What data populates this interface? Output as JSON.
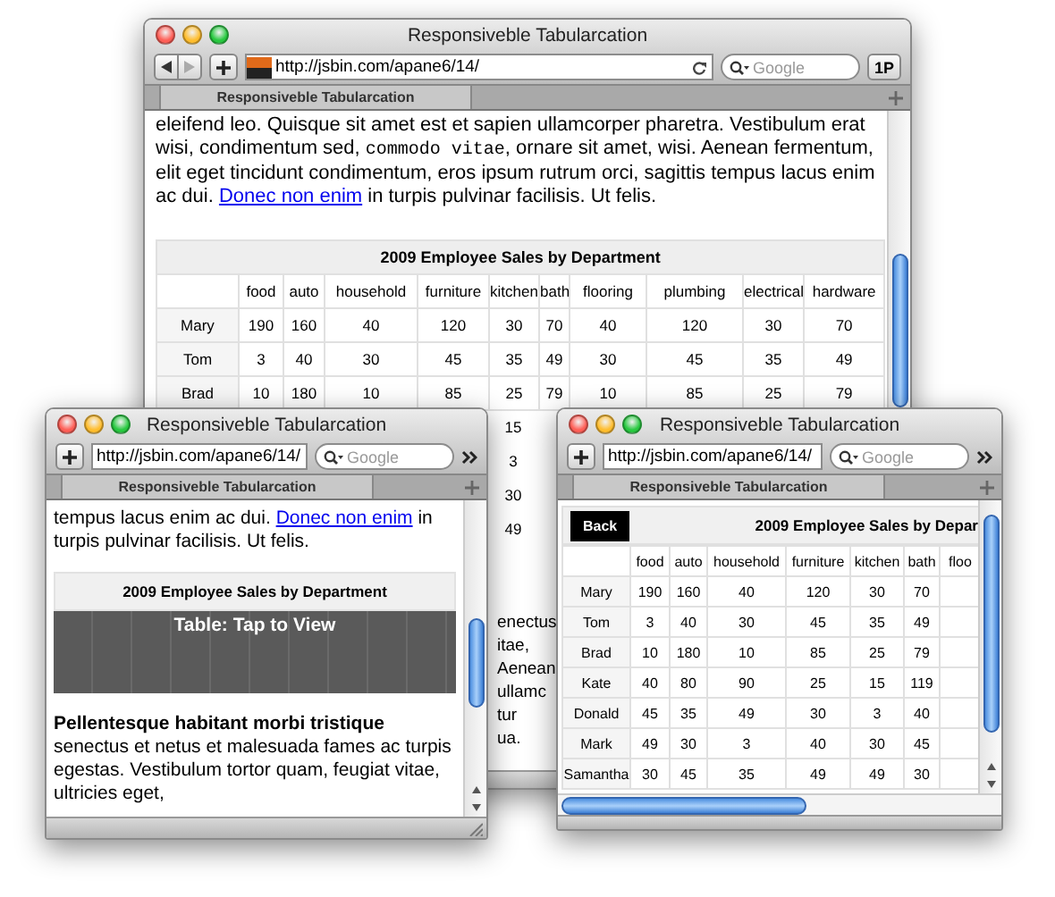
{
  "windows": [
    {
      "kind": "main",
      "title": "Responsiveble Tabularcation",
      "url": "http://jsbin.com/apane6/14/",
      "search_placeholder": "Google",
      "toolbar_button": "1P",
      "tab_label": "Responsiveble Tabularcation",
      "paragraph": [
        {
          "kind": "text",
          "text": "eleifend leo. Quisque sit amet est et sapien ullamcorper pharetra. Vestibulum erat wisi, condimentum sed, "
        },
        {
          "kind": "code",
          "text": "commodo vitae"
        },
        {
          "kind": "text",
          "text": ", ornare sit amet, wisi. Aenean fermentum, elit eget tincidunt condimentum, eros ipsum rutrum orci, sagittis tempus lacus enim ac dui. "
        },
        {
          "kind": "link",
          "text": "Donec non enim"
        },
        {
          "kind": "text",
          "text": " in turpis pulvinar facilisis. Ut felis."
        }
      ],
      "table": {
        "caption": "2009 Employee Sales by Department",
        "columns": [
          "food",
          "auto",
          "household",
          "furniture",
          "kitchen",
          "bath",
          "flooring",
          "plumbing",
          "electrical",
          "hardware"
        ],
        "rows": [
          {
            "name": "Mary",
            "values": [
              "190",
              "160",
              "40",
              "120",
              "30",
              "70",
              "40",
              "120",
              "30",
              "70"
            ]
          },
          {
            "name": "Tom",
            "values": [
              "3",
              "40",
              "30",
              "45",
              "35",
              "49",
              "30",
              "45",
              "35",
              "49"
            ]
          },
          {
            "name": "Brad",
            "values": [
              "10",
              "180",
              "10",
              "85",
              "25",
              "79",
              "10",
              "85",
              "25",
              "79"
            ]
          }
        ]
      },
      "kitchen_column_fragments": [
        "15",
        "3",
        "30",
        "49"
      ],
      "text_fragments": [
        "enectus",
        "itae,",
        "Aenean",
        "ullamc",
        "tur",
        "ua."
      ]
    },
    {
      "kind": "collapsed",
      "title": "Responsiveble Tabularcation",
      "url": "http://jsbin.com/apane6/14/",
      "search_placeholder": "Google",
      "tab_label": "Responsiveble Tabularcation",
      "paragraph": [
        {
          "kind": "text",
          "text": "tempus lacus enim ac dui. "
        },
        {
          "kind": "link",
          "text": "Donec non enim"
        },
        {
          "kind": "text",
          "text": " in turpis pulvinar facilisis. Ut felis."
        }
      ],
      "table_caption": "2009 Employee Sales by Department",
      "tap_button": "Table: Tap to View",
      "paragraph_2": [
        {
          "kind": "bold",
          "text": "Pellentesque habitant morbi tristique"
        },
        {
          "kind": "text",
          "text": " senectus et netus et malesuada fames ac turpis egestas. Vestibulum tortor quam, feugiat vitae, ultricies eget,"
        }
      ]
    },
    {
      "kind": "expanded",
      "title": "Responsiveble Tabularcation",
      "url": "http://jsbin.com/apane6/14/",
      "search_placeholder": "Google",
      "tab_label": "Responsiveble Tabularcation",
      "back_button": "Back",
      "table": {
        "caption": "2009 Employee Sales by Depar",
        "columns": [
          "food",
          "auto",
          "household",
          "furniture",
          "kitchen",
          "bath",
          "floo"
        ],
        "rows": [
          {
            "name": "Mary",
            "values": [
              "190",
              "160",
              "40",
              "120",
              "30",
              "70"
            ]
          },
          {
            "name": "Tom",
            "values": [
              "3",
              "40",
              "30",
              "45",
              "35",
              "49"
            ]
          },
          {
            "name": "Brad",
            "values": [
              "10",
              "180",
              "10",
              "85",
              "25",
              "79"
            ]
          },
          {
            "name": "Kate",
            "values": [
              "40",
              "80",
              "90",
              "25",
              "15",
              "119"
            ]
          },
          {
            "name": "Donald",
            "values": [
              "45",
              "35",
              "49",
              "30",
              "3",
              "40"
            ]
          },
          {
            "name": "Mark",
            "values": [
              "49",
              "30",
              "3",
              "40",
              "30",
              "45"
            ]
          },
          {
            "name": "Samantha",
            "values": [
              "30",
              "45",
              "35",
              "49",
              "49",
              "30"
            ]
          }
        ]
      }
    }
  ]
}
